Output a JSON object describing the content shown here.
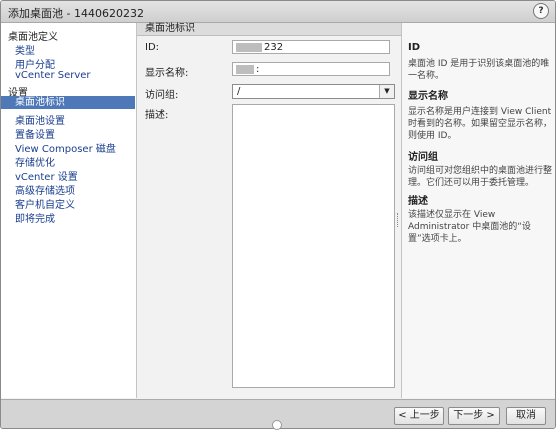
{
  "window": {
    "title": "添加桌面池 - 1440620232",
    "help_glyph": "?"
  },
  "sidebar": {
    "groups": [
      {
        "label": "桌面池定义",
        "items": [
          "类型",
          "用户分配",
          "vCenter Server"
        ]
      },
      {
        "label": "设置",
        "items": [
          "桌面池标识",
          "桌面池设置",
          "置备设置",
          "View Composer 磁盘",
          "存储优化",
          "vCenter 设置",
          "高级存储选项",
          "客户机自定义",
          "即将完成"
        ]
      }
    ],
    "selected": "桌面池标识"
  },
  "form": {
    "header": "桌面池标识",
    "id_label": "ID:",
    "id_value_visible": "232",
    "display_name_label": "显示名称:",
    "display_name_value_visible": ":",
    "access_group_label": "访问组:",
    "access_group_value": "/",
    "description_label": "描述:",
    "dropdown_arrow": "▼"
  },
  "help": {
    "sections": [
      {
        "title": "ID",
        "text": "桌面池 ID 是用于识别该桌面池的唯一名称。"
      },
      {
        "title": "显示名称",
        "text": "显示名称是用户连接到 View Client 时看到的名称。如果留空显示名称，则使用 ID。"
      },
      {
        "title": "访问组",
        "text": "访问组可对您组织中的桌面池进行整理。它们还可以用于委托管理。"
      },
      {
        "title": "描述",
        "text": "该描述仅显示在 View Administrator 中桌面池的“设置”选项卡上。"
      }
    ]
  },
  "footer": {
    "back_label": "< 上一步",
    "next_label": "下一步 >",
    "cancel_label": "取消"
  }
}
